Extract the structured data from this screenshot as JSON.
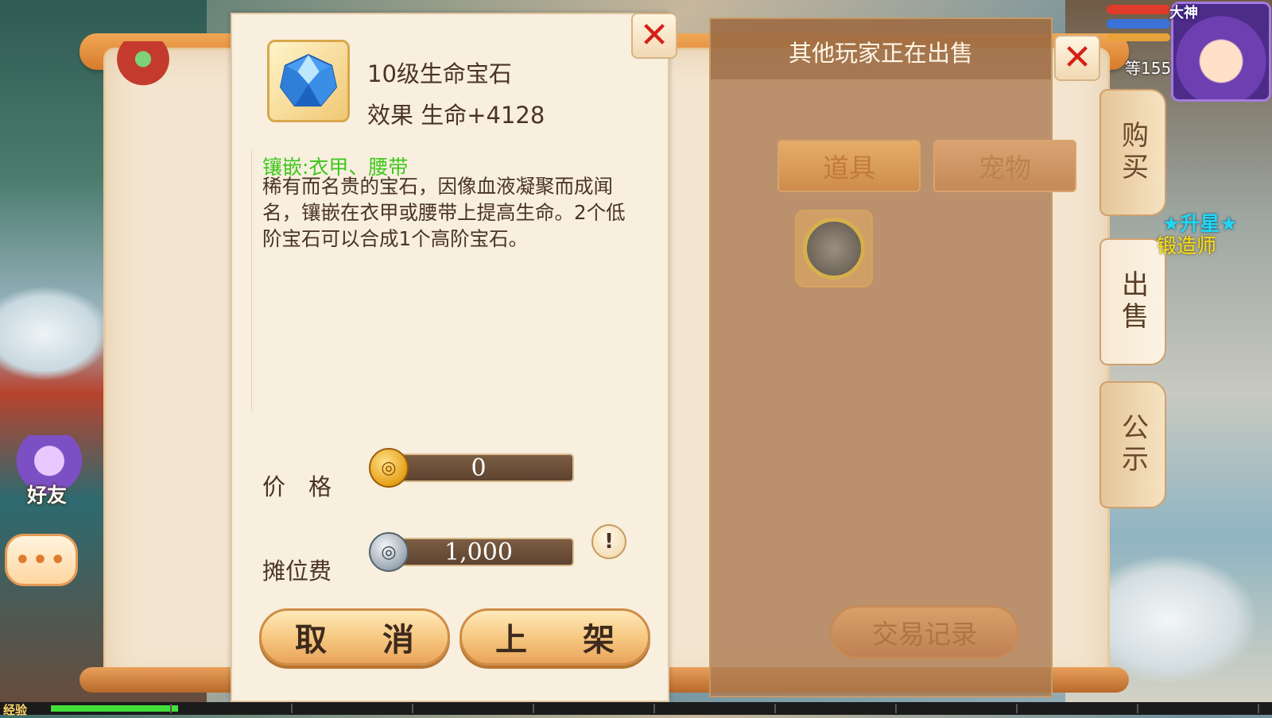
{
  "item": {
    "name": "10级生命宝石",
    "effect": "效果 生命+4128",
    "embed": "镶嵌:衣甲、腰带",
    "description": "稀有而名贵的宝石，因像血液凝聚而成闻名，镶嵌在衣甲或腰带上提高生命。2个低阶宝石可以合成1个高阶宝石。",
    "icon": "blue-gem-icon"
  },
  "price": {
    "label": "价　格",
    "value": "0",
    "currency_icon": "gold-coin-icon"
  },
  "stall_fee": {
    "label": "摊位费",
    "value": "1,000",
    "currency_icon": "silver-coin-icon"
  },
  "buttons": {
    "cancel": "取 消",
    "list": "上 架"
  },
  "market": {
    "title": "其他玩家正在出售",
    "tabs": [
      {
        "label": "道具"
      },
      {
        "label": "宠物"
      }
    ],
    "record_button": "交易记录"
  },
  "side_tabs": [
    {
      "label": "购买"
    },
    {
      "label": "出售"
    },
    {
      "label": "公示"
    }
  ],
  "hud": {
    "avatar_tag": "大神",
    "level_text": "等155",
    "star_text": "★升星★",
    "job_text": "锻造师",
    "friend_label": "好友",
    "chat_glyph": "•••",
    "exp_label": "经验",
    "exp_progress": 0.1
  },
  "colors": {
    "embed": "#3ec81d",
    "close": "#d51f17",
    "accent": "#e8a05a"
  }
}
